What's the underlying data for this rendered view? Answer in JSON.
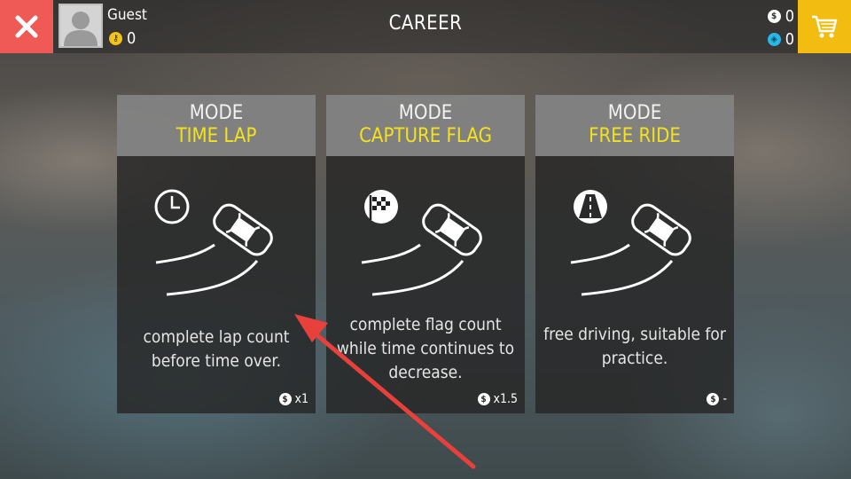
{
  "header": {
    "title": "CAREER",
    "user": {
      "name": "Guest",
      "keys": "0"
    },
    "currency": {
      "coins": "0",
      "gems": "0"
    }
  },
  "cards": [
    {
      "mode_label": "MODE",
      "name": "TIME LAP",
      "description": "complete lap count before time over.",
      "multiplier": "x1",
      "mode_icon": "clock-icon"
    },
    {
      "mode_label": "MODE",
      "name": "CAPTURE FLAG",
      "description": "complete flag count while time continues to decrease.",
      "multiplier": "x1.5",
      "mode_icon": "checkered-flag-icon"
    },
    {
      "mode_label": "MODE",
      "name": "FREE RIDE",
      "description": "free driving, suitable for practice.",
      "multiplier": "-",
      "mode_icon": "road-icon"
    }
  ],
  "colors": {
    "close": "#ef5a57",
    "shop": "#f2bd10",
    "mode_name": "#f3e21c",
    "annotation_arrow": "#e8403a"
  }
}
